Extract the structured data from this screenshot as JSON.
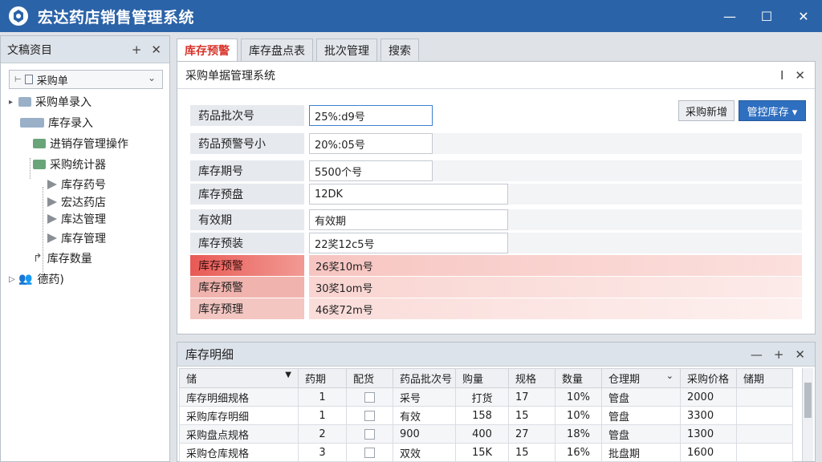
{
  "app": {
    "title": "宏达药店销售管理系统",
    "accent": "#2b63a8"
  },
  "window_buttons": {
    "minimize": "—",
    "maximize": "☐",
    "close": "✕"
  },
  "left_panel": {
    "title": "文稿资目",
    "combo_value": "采购单",
    "tree": [
      {
        "label": "采购单录入",
        "icon": "folder-icon"
      },
      {
        "label": "库存录入",
        "icon": "folder-icon"
      },
      {
        "label": "进销存管理操作",
        "icon": "sheet-icon"
      },
      {
        "label": "采购统计器",
        "icon": "sheet-icon"
      },
      {
        "label": "库存药号",
        "icon": "doc-icon"
      },
      {
        "label": "宏达药店",
        "icon": "doc-icon"
      },
      {
        "label": "库达管理",
        "icon": "doc-icon"
      },
      {
        "label": "库存管理",
        "icon": "doc-icon"
      },
      {
        "label": "库存数量",
        "icon": "arrow-icon"
      },
      {
        "label": "德药)",
        "icon": "people-icon"
      }
    ]
  },
  "tabs": [
    {
      "label": "库存预警",
      "active": true
    },
    {
      "label": "库存盘点表",
      "active": false
    },
    {
      "label": "批次管理",
      "active": false
    },
    {
      "label": "搜索",
      "active": false
    }
  ],
  "form": {
    "header": "采购单据管理系统",
    "button_secondary": "采购新增",
    "button_primary": "管控库存 ▾",
    "rows": [
      {
        "label": "药品批次号",
        "value": "25%:d9号"
      },
      {
        "label": "药品预警号小",
        "value": "20%:05号"
      },
      {
        "label": "库存期号",
        "value": "5500个号"
      },
      {
        "label": "库存预盘",
        "value": "12DK"
      },
      {
        "label": "有效期",
        "value": "有效期"
      },
      {
        "label": "库存预装",
        "value": "22奖12c5号"
      },
      {
        "label": "库存预警",
        "value": "26奖10m号"
      },
      {
        "label": "库存预警",
        "value": "30奖1om号"
      },
      {
        "label": "库存预理",
        "value": "46奖72m号"
      }
    ]
  },
  "detail": {
    "title": "库存明细",
    "columns": [
      "储",
      "药期",
      "配货",
      "药品批次号",
      "购量",
      "规格",
      "数量",
      "仓理期",
      "采购价格",
      "储期"
    ],
    "rows": [
      [
        "库存明细规格",
        "1",
        "",
        "采号",
        "打货",
        "17",
        "10%",
        "管盘",
        "2000",
        ""
      ],
      [
        "采购库存明细",
        "1",
        "",
        "有效",
        "158",
        "15",
        "10%",
        "管盘",
        "3300",
        ""
      ],
      [
        "采购盘点规格",
        "2",
        "",
        "900",
        "400",
        "27",
        "18%",
        "管盘",
        "1300",
        ""
      ],
      [
        "采购仓库规格",
        "3",
        "",
        "双效",
        "15K",
        "15",
        "16%",
        "批盘期",
        "1600",
        ""
      ]
    ]
  }
}
